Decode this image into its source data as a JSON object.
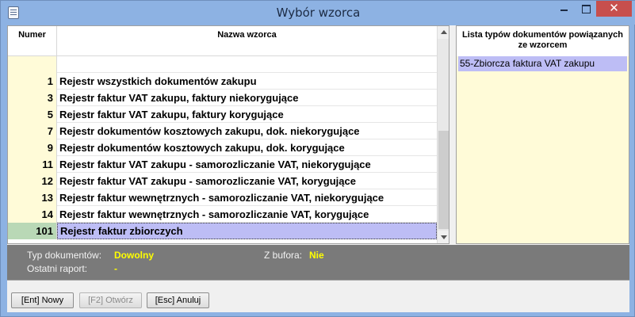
{
  "window": {
    "title": "Wybór wzorca"
  },
  "grid": {
    "col_number": "Numer",
    "col_name": "Nazwa wzorca",
    "rows": [
      {
        "num": "1",
        "name": "Rejestr wszystkich dokumentów zakupu"
      },
      {
        "num": "3",
        "name": "Rejestr faktur VAT zakupu, faktury niekorygujące"
      },
      {
        "num": "5",
        "name": "Rejestr faktur VAT zakupu, faktury korygujące"
      },
      {
        "num": "7",
        "name": "Rejestr dokumentów kosztowych zakupu, dok. niekorygujące"
      },
      {
        "num": "9",
        "name": "Rejestr dokumentów kosztowych zakupu, dok. korygujące"
      },
      {
        "num": "11",
        "name": "Rejestr faktur VAT zakupu - samorozliczanie VAT, niekorygujące"
      },
      {
        "num": "12",
        "name": "Rejestr faktur VAT zakupu - samorozliczanie VAT, korygujące"
      },
      {
        "num": "13",
        "name": "Rejestr faktur wewnętrznych - samorozliczanie VAT, niekorygujące"
      },
      {
        "num": "14",
        "name": "Rejestr faktur wewnętrznych - samorozliczanie VAT, korygujące"
      },
      {
        "num": "101",
        "name": "Rejestr faktur zbiorczych"
      }
    ]
  },
  "doc_types": {
    "header": "Lista typów dokumentów powiązanych ze wzorcem",
    "items": [
      "55-Zbiorcza faktura VAT zakupu"
    ]
  },
  "info": {
    "doc_type_label": "Typ dokumentów:",
    "doc_type_value": "Dowolny",
    "buffer_label": "Z bufora:",
    "buffer_value": "Nie",
    "last_report_label": "Ostatni raport:",
    "last_report_value": "-"
  },
  "buttons": {
    "new_label": "[Ent] Nowy",
    "open_label": "[F2] Otwórz",
    "cancel_label": "[Esc] Anuluj"
  },
  "colors": {
    "selected_row": "#bdbdf5",
    "number_column": "#fffbd8",
    "info_value": "#ffff00",
    "close_button": "#c74f4d"
  }
}
